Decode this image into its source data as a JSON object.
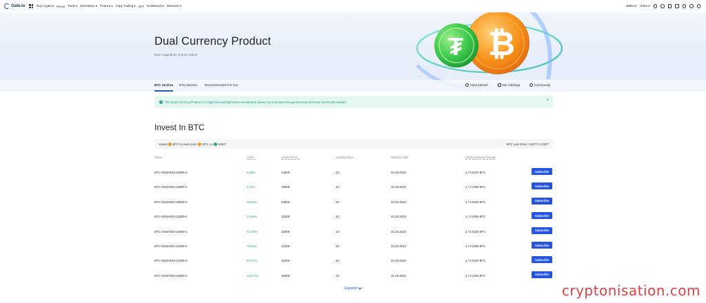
{
  "nav": {
    "logo_text": "Gate.io",
    "items": [
      "Buy Crypto ▾",
      "Prices",
      "Trade ▾",
      "Derivatives ▾",
      "Finance ▾",
      "Copy Trading ▾",
      "NFT",
      "Institutional ▾",
      "Moments ▾"
    ],
    "wallet_label": "Wallet ▾",
    "order_label": "Order ▾"
  },
  "hero": {
    "title": "Dual Currency Product",
    "subtitle": "Earn regardless of price action"
  },
  "subnav": {
    "tabs": [
      "BTC Section",
      "ETH Section",
      "Recommended For You"
    ],
    "view_tutorial": "View tutorial",
    "my_holdings": "My Holdings",
    "community": "Community"
  },
  "notice": {
    "text": "The Dual Currency Product is a high risk and high return investment, please try to answer the questionnaire first and invest with caution.",
    "close": "×"
  },
  "section": {
    "title": "Invest In BTC",
    "invest_word": "Invest",
    "invest_coin": "BTC",
    "to_earn": "to earn more",
    "earn_coin1": "BTC",
    "or_word": "or",
    "earn_coin2": "USDT",
    "last_price": "BTC Last Price: 21677.2 USDT"
  },
  "table": {
    "headers": [
      "Name",
      "APR ↕",
      "Linked Price ↕",
      "Holding Days ↕",
      "Maturity Date",
      "Starting Share/Amount"
    ],
    "button_label": "Subscribe",
    "rows": [
      {
        "name": "BTC-31MAR23-24000-C",
        "apr": "9.89%",
        "price": "24000",
        "days": "22",
        "date": "31.03.2023",
        "share": "1 / 0.0100 BTC"
      },
      {
        "name": "BTC-31MAR23-23000-C",
        "apr": "5.47%",
        "price": "23000",
        "days": "22",
        "date": "31.03.2023",
        "share": "1 / 0.1000 BTC"
      },
      {
        "name": "BTC-31MAR23-23000-C",
        "apr": "25.63%",
        "price": "23000",
        "days": "22",
        "date": "31.03.2023",
        "share": "1 / 0.0100 BTC"
      },
      {
        "name": "BTC-31MAR23-22000-C",
        "apr": "33.56%",
        "price": "22000",
        "days": "22",
        "date": "31.03.2023",
        "share": "1 / 0.1000 BTC"
      },
      {
        "name": "BTC-31MAR23-22000-C",
        "apr": "52.30%",
        "price": "22000",
        "days": "22",
        "date": "31.03.2023",
        "share": "1 / 0.0100 BTC"
      },
      {
        "name": "BTC-31MAR23-21000-C",
        "apr": "76.52%",
        "price": "21000",
        "days": "22",
        "date": "31.03.2023",
        "share": "1 / 0.1000 BTC"
      },
      {
        "name": "BTC-31MAR23-21000-C",
        "apr": "91.71%",
        "price": "21000",
        "days": "22",
        "date": "31.03.2023",
        "share": "1 / 0.0100 BTC"
      },
      {
        "name": "BTC-31MAR23-20000-C",
        "apr": "129.27%",
        "price": "20000",
        "days": "22",
        "date": "31.03.2023",
        "share": "1 / 0.1000 BTC"
      }
    ]
  },
  "expand_label": "Expand",
  "watermark": "cryptonisation.com",
  "colors": {
    "accent": "#2354e6",
    "apr_green": "#14b07a",
    "notice_bg": "#e5f7f1",
    "watermark": "#d64545"
  }
}
